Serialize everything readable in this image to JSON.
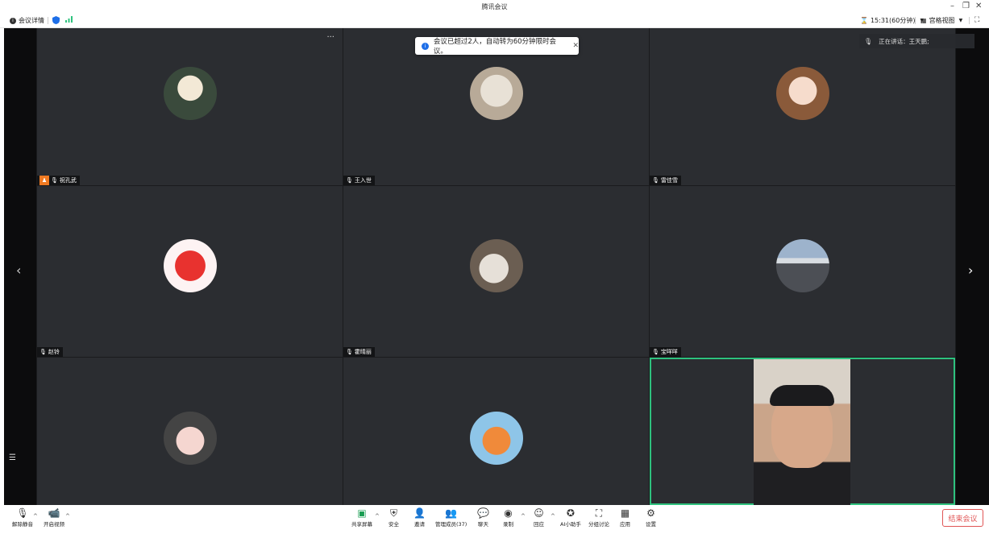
{
  "window": {
    "title": "腾讯会议"
  },
  "topbar": {
    "meeting_info": "会议详情",
    "time_label": "15:31(60分钟)",
    "view_label": "宫格视图"
  },
  "toast": {
    "message": "会议已超过2人，自动转为60分钟限时会议。"
  },
  "speaking": {
    "label": "正在讲话：王天鹏;"
  },
  "participants": [
    {
      "name": "祝孔武",
      "host": true
    },
    {
      "name": "王入世",
      "host": false
    },
    {
      "name": "雷佳雪",
      "host": false
    },
    {
      "name": "赵铃",
      "host": false
    },
    {
      "name": "霍晴丽",
      "host": false
    },
    {
      "name": "宝咩咩",
      "host": false
    },
    {
      "name": "",
      "host": false
    },
    {
      "name": "",
      "host": false
    },
    {
      "name": "",
      "host": false
    }
  ],
  "controls": {
    "unmute": "解除静音",
    "video": "开启视频",
    "share": "共享屏幕",
    "security": "安全",
    "invite": "邀请",
    "members": "管理成员(37)",
    "chat": "聊天",
    "record": "录制",
    "reaction": "回应",
    "ai": "AI小助手",
    "breakout": "分组讨论",
    "apps": "应用",
    "settings": "设置",
    "end": "结束会议"
  },
  "colors": {
    "accent": "#0d6efd",
    "end": "#e05555",
    "active_border": "#2ec27e"
  }
}
